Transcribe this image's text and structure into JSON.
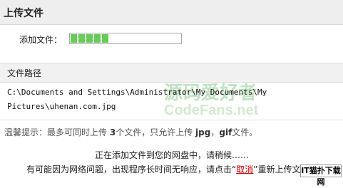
{
  "header": {
    "title": "上传文件"
  },
  "add_file": {
    "label": "添加文件：",
    "progress_fraction": 0.35,
    "segments": 5
  },
  "path_section": {
    "heading": "文件路径",
    "line1": "C:\\Documents and Settings\\Administrator\\My Documents\\My",
    "line2": "Pictures\\uhenan.com.jpg"
  },
  "tip": {
    "prefix": "温馨提示：最多可同时上传",
    "count": "3",
    "mid": "个文件，只允许上传",
    "ext1": "jpg",
    "sep": "，",
    "ext2": "gif",
    "suffix": "文件。"
  },
  "status": {
    "line1": "正在添加文件到您的网盘中，请稍候……",
    "line2_prefix": "有可能因为网络问题，出现程序长时间无响应，请点击“",
    "cancel": "取消",
    "line2_suffix": "”重新上传文件。"
  },
  "watermark": {
    "text": "源码爱好者",
    "sub": "CodeFans.net"
  },
  "badge": {
    "text": "IT猫扑下载网"
  }
}
